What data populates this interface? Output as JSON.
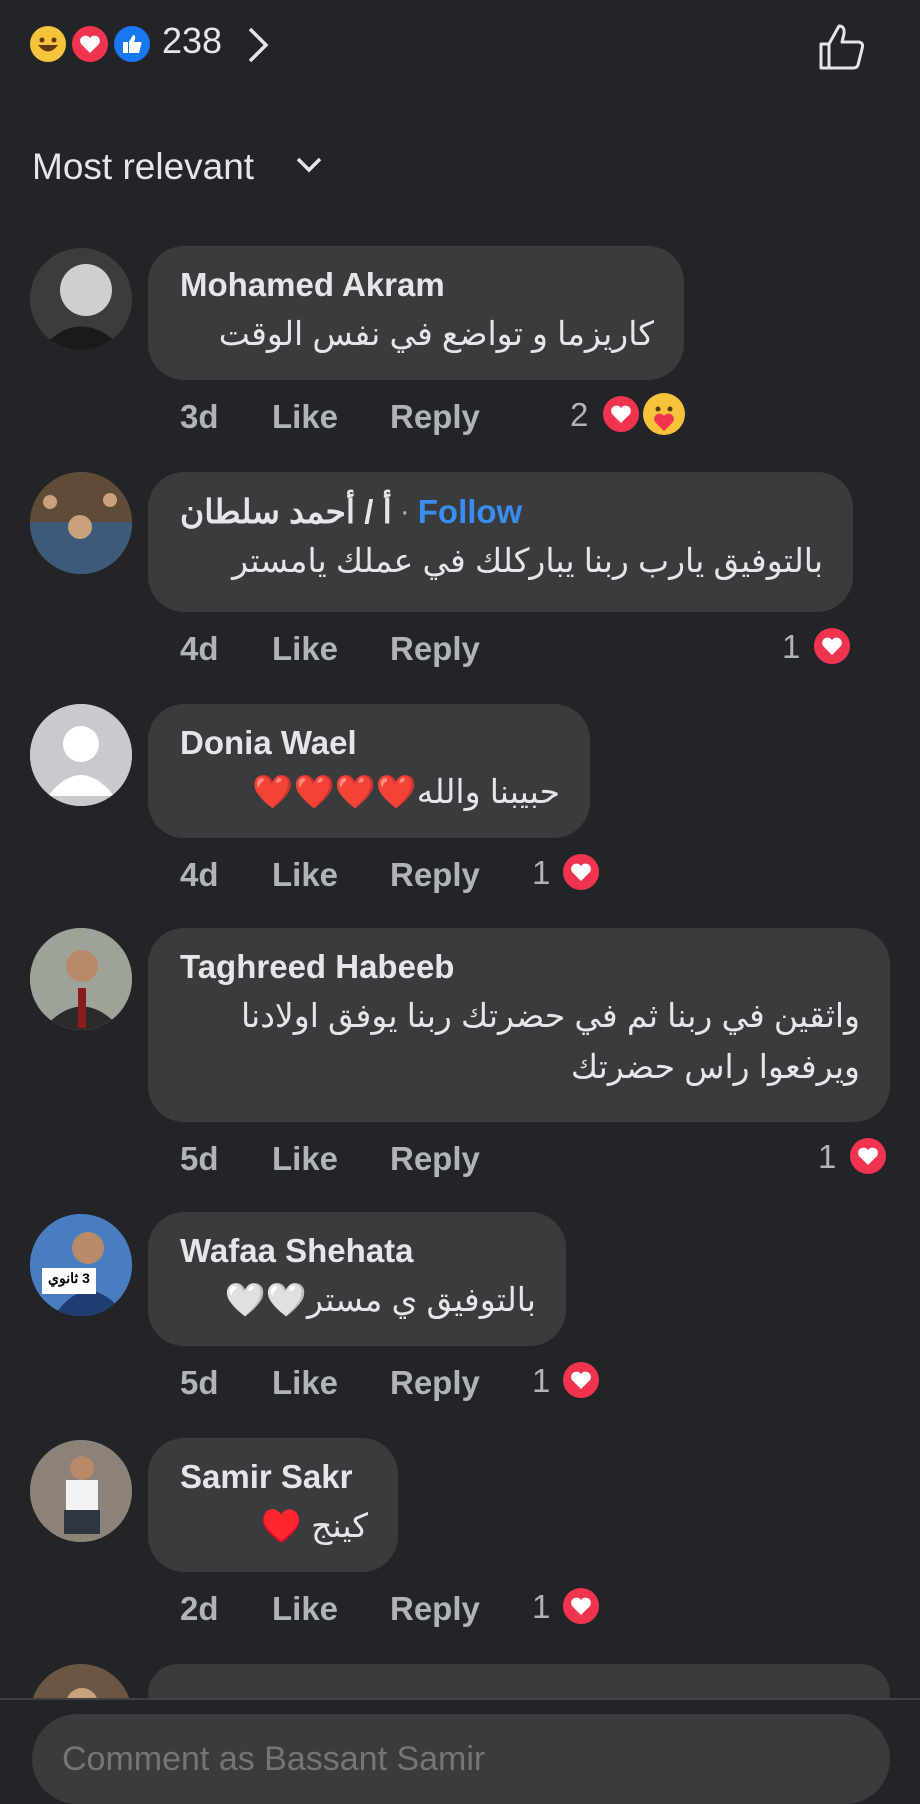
{
  "header": {
    "reactions": [
      "haha-icon",
      "love-icon",
      "like-icon"
    ],
    "reaction_count": "238",
    "sort_label": "Most relevant"
  },
  "comments": [
    {
      "name": "Mohamed Akram",
      "text": "كاريزما و تواضع في نفس الوقت",
      "time": "3d",
      "like": "Like",
      "reply": "Reply",
      "reaction_count": "2"
    },
    {
      "name": "أ / أحمد سلطان",
      "follow": "Follow",
      "text": "بالتوفيق يارب ربنا يباركلك في عملك يامستر",
      "time": "4d",
      "like": "Like",
      "reply": "Reply",
      "reaction_count": "1"
    },
    {
      "name": "Donia Wael",
      "text": "حبيبنا والله❤️❤️❤️❤️",
      "time": "4d",
      "like": "Like",
      "reply": "Reply",
      "reaction_count": "1"
    },
    {
      "name": "Taghreed Habeeb",
      "text_line1": "واثقين في ربنا ثم في حضرتك ربنا يوفق اولادنا",
      "text_line2": "ويرفعوا راس حضرتك",
      "time": "5d",
      "like": "Like",
      "reply": "Reply",
      "reaction_count": "1"
    },
    {
      "name": "Wafaa Shehata",
      "avatar_badge": "3 ثانوي",
      "text": "بالتوفيق ي مستر🤍🤍",
      "time": "5d",
      "like": "Like",
      "reply": "Reply",
      "reaction_count": "1"
    },
    {
      "name": "Samir Sakr",
      "text": "كينج ♥️",
      "time": "2d",
      "like": "Like",
      "reply": "Reply",
      "reaction_count": "1"
    }
  ],
  "composer": {
    "placeholder": "Comment as Bassant Samir"
  },
  "colors": {
    "love": "#f0334f",
    "haha": "#f7c33a",
    "like": "#1877f2",
    "follow": "#3b8cf0",
    "bubble": "#3a3b3c",
    "background": "#232427"
  }
}
